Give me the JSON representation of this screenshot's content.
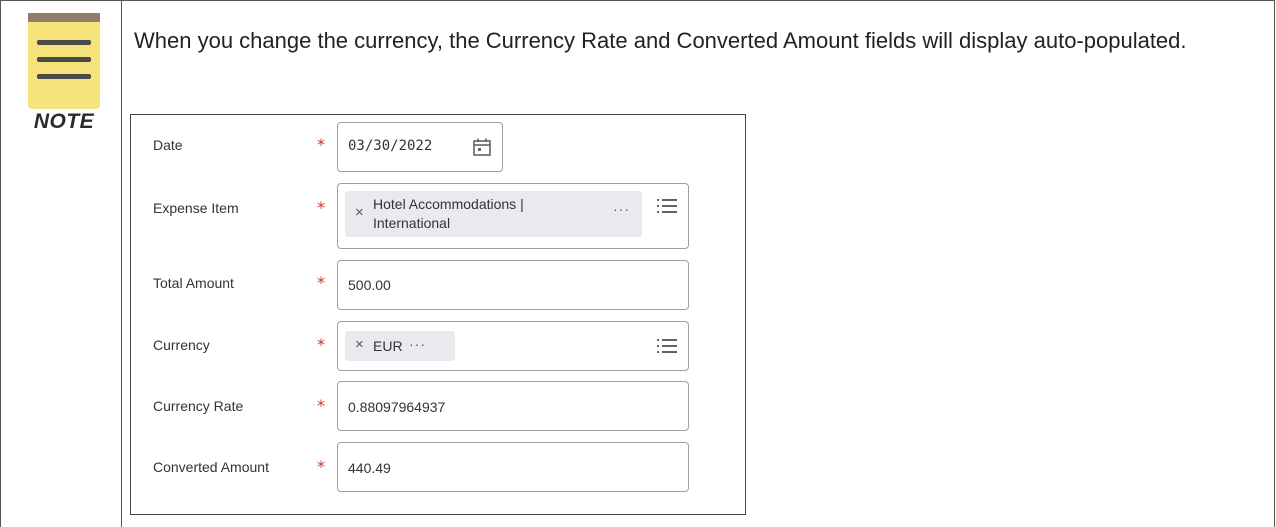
{
  "note": {
    "label": "NOTE",
    "text": "When you change the currency, the Currency Rate and Converted Amount fields will display auto-populated."
  },
  "form": {
    "required_mark": "*",
    "date": {
      "label": "Date",
      "value": "03/30/2022",
      "icon": "calendar-icon"
    },
    "expense_item": {
      "label": "Expense Item",
      "value_line1": "Hotel Accommodations |",
      "value_line2": "International",
      "remove": "×",
      "more": "···",
      "icon": "list-icon"
    },
    "total_amount": {
      "label": "Total Amount",
      "value": "500.00"
    },
    "currency": {
      "label": "Currency",
      "value": "EUR",
      "remove": "×",
      "more": "···",
      "icon": "list-icon"
    },
    "currency_rate": {
      "label": "Currency Rate",
      "value": "0.88097964937"
    },
    "converted_amount": {
      "label": "Converted Amount",
      "value": "440.49"
    }
  },
  "colors": {
    "required": "#d0342c",
    "note_pad": "#f7e37c",
    "note_pad_top": "#8e7d68"
  }
}
